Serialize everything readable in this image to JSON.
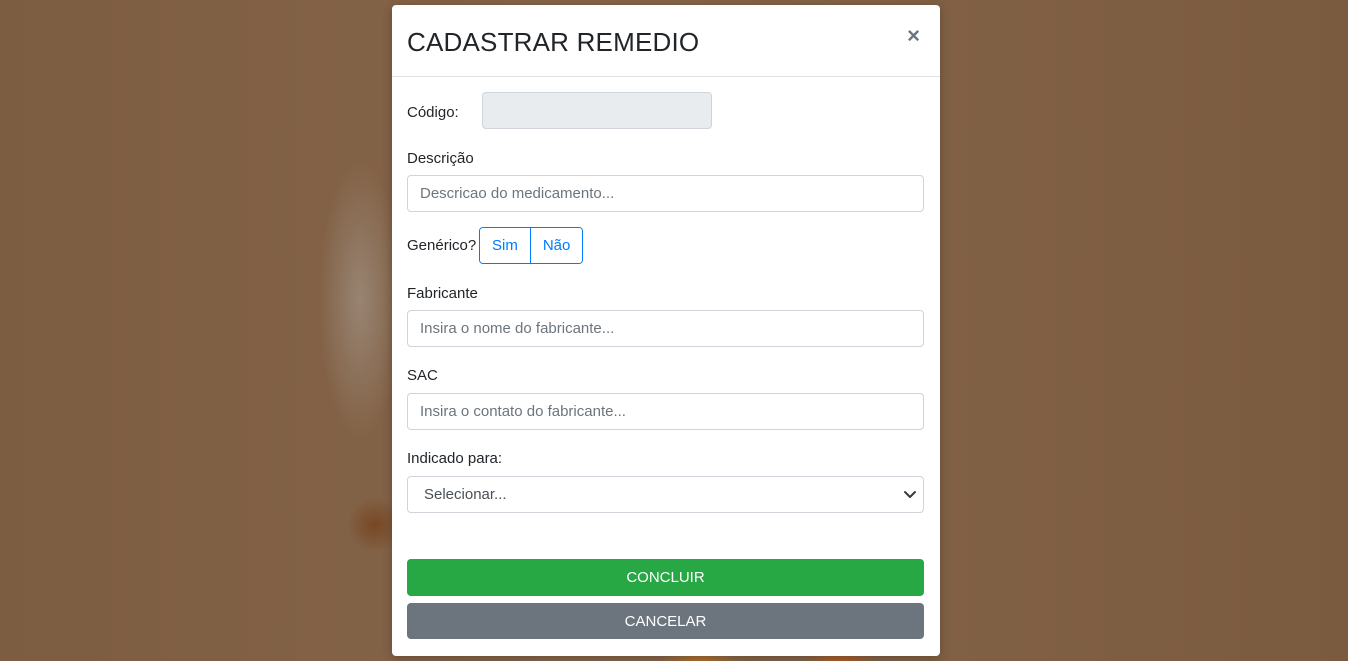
{
  "modal": {
    "title": "CADASTRAR REMEDIO",
    "close_symbol": "×",
    "close_icon": "close-icon"
  },
  "form": {
    "codigo": {
      "label": "Código:",
      "value": "",
      "readonly": true
    },
    "descricao": {
      "label": "Descrição",
      "placeholder": "Descricao do medicamento...",
      "value": ""
    },
    "generico": {
      "label": "Genérico?",
      "options": [
        "Sim",
        "Não"
      ]
    },
    "fabricante": {
      "label": "Fabricante",
      "placeholder": "Insira o nome do fabricante...",
      "value": ""
    },
    "sac": {
      "label": "SAC",
      "placeholder": "Insira o contato do fabricante...",
      "value": ""
    },
    "indicado": {
      "label": "Indicado para:",
      "selected": "Selecionar...",
      "chevron_icon": "chevron-down-icon"
    }
  },
  "actions": {
    "confirm_label": "CONCLUIR",
    "cancel_label": "CANCELAR"
  },
  "colors": {
    "primary": "#007bff",
    "success": "#28a745",
    "secondary": "#6c757d",
    "input_readonly_bg": "#e9ecef"
  }
}
